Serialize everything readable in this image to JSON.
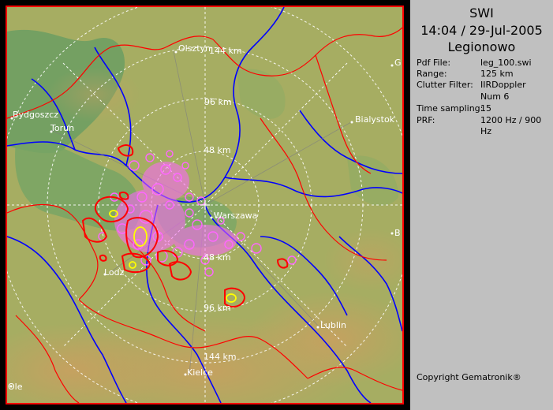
{
  "panel": {
    "product": "SWI",
    "datetime": "14:04 / 29-Jul-2005",
    "site": "Legionowo",
    "fields": [
      {
        "label": "Pdf File:",
        "value": "leg_100.swi"
      },
      {
        "label": "Range:",
        "value": "125 km"
      },
      {
        "label": "Clutter Filter:",
        "value": "IIRDoppler"
      },
      {
        "label": "",
        "value": "Num 6"
      },
      {
        "label": "Time sampling:",
        "value": "15"
      },
      {
        "label": "PRF:",
        "value": "1200 Hz / 900 Hz"
      }
    ],
    "copyright": "Copyright Gematronik®"
  },
  "map": {
    "range_rings": [
      "144 km",
      "96 km",
      "48 km",
      "48 km",
      "96 km",
      "144 km"
    ],
    "cities": [
      "Olsztyn",
      "Bydgoszcz",
      "Torun",
      "Bialystok",
      "Warszawa",
      "Lodz",
      "Lublin",
      "Kielce",
      "Ole",
      "G",
      "B"
    ]
  },
  "colors": {
    "panel_bg": "#c0c0c0",
    "map_bg": "#a8b060",
    "forest": "#6a9a60",
    "river": "#0000ff",
    "border": "#ff0000",
    "echo_pink": "#ff66ff",
    "echo_red": "#ff0000",
    "echo_yellow": "#ffff00"
  }
}
